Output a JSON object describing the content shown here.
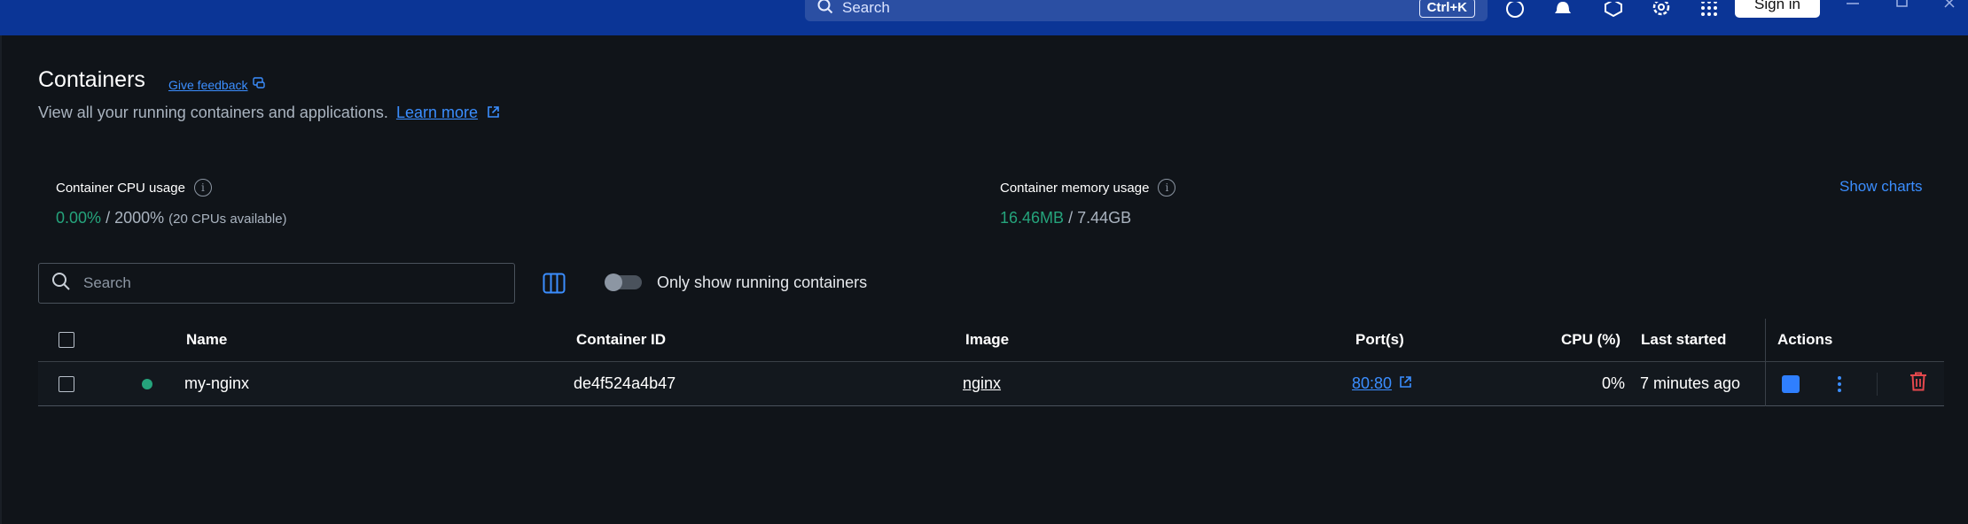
{
  "titlebar": {
    "search_placeholder": "Search",
    "search_shortcut": "Ctrl+K",
    "sign_in_label": "Sign in"
  },
  "page": {
    "title": "Containers",
    "feedback_label": "Give feedback",
    "subtitle": "View all your running containers and applications.",
    "learn_more": "Learn more"
  },
  "stats": {
    "cpu": {
      "label": "Container CPU usage",
      "used": "0.00%",
      "total": "/ 2000%",
      "note": "(20 CPUs available)"
    },
    "memory": {
      "label": "Container memory usage",
      "used": "16.46MB",
      "total": "/ 7.44GB"
    },
    "show_charts": "Show charts"
  },
  "filters": {
    "search_placeholder": "Search",
    "running_only_label": "Only show running containers",
    "running_only_enabled": false
  },
  "table": {
    "headers": {
      "name": "Name",
      "container_id": "Container ID",
      "image": "Image",
      "ports": "Port(s)",
      "cpu": "CPU (%)",
      "last_started": "Last started",
      "actions": "Actions"
    },
    "rows": [
      {
        "name": "my-nginx",
        "status": "running",
        "container_id": "de4f524a4b47",
        "image": "nginx",
        "ports": "80:80",
        "cpu": "0%",
        "last_started": "7 minutes ago"
      }
    ]
  },
  "colors": {
    "titlebar": "#0b3596",
    "accent": "#3b8eff",
    "running": "#25a47c",
    "delete": "#e5484d"
  }
}
